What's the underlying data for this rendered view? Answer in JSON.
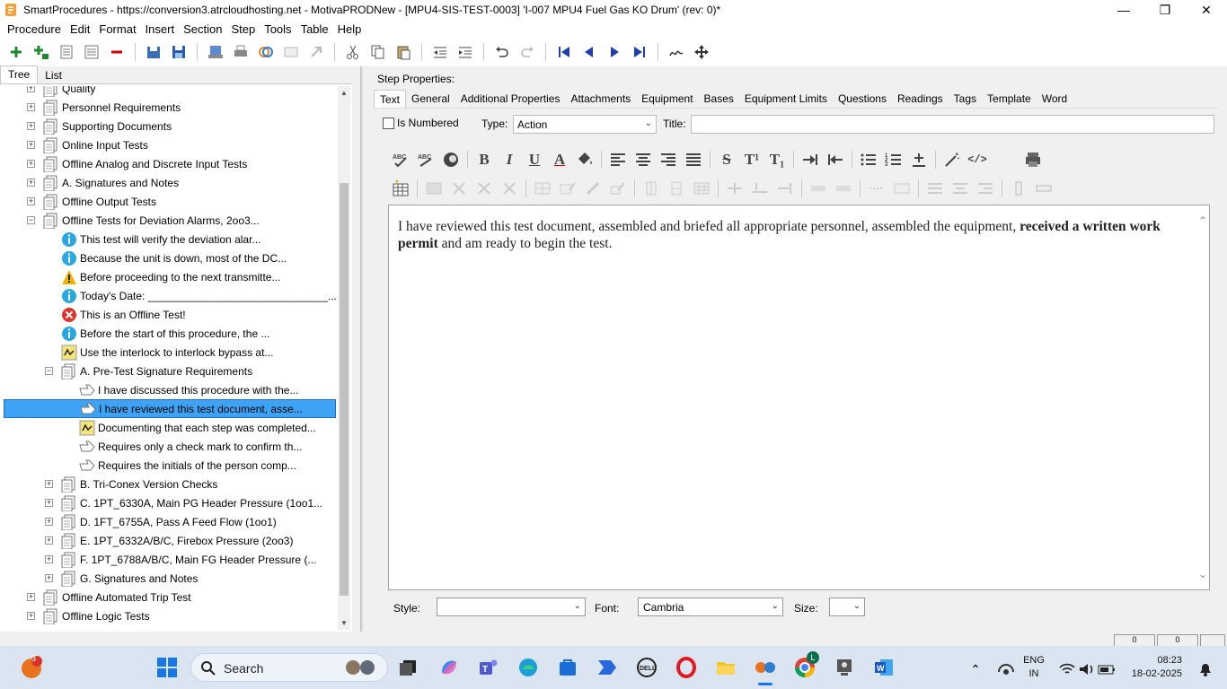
{
  "window": {
    "title": "SmartProcedures - https://conversion3.atrcloudhosting.net - MotivaPRODNew - [MPU4-SIS-TEST-0003] 'I-007 MPU4 Fuel Gas KO Drum' (rev: 0)*",
    "minimize": "—",
    "restore": "❐",
    "close": "✕"
  },
  "menu": [
    "Procedure",
    "Edit",
    "Format",
    "Insert",
    "Section",
    "Step",
    "Tools",
    "Table",
    "Help"
  ],
  "left_tabs": {
    "tree": "Tree",
    "list": "List"
  },
  "tree": [
    {
      "label": "Quality",
      "level": 0,
      "exp": "+",
      "icon": "section"
    },
    {
      "label": "Personnel Requirements",
      "level": 0,
      "exp": "+",
      "icon": "section"
    },
    {
      "label": "Supporting Documents",
      "level": 0,
      "exp": "+",
      "icon": "section"
    },
    {
      "label": "Online Input Tests",
      "level": 0,
      "exp": "+",
      "icon": "section"
    },
    {
      "label": "Offline Analog and Discrete Input Tests",
      "level": 0,
      "exp": "+",
      "icon": "section"
    },
    {
      "label": "A. Signatures and Notes",
      "level": 0,
      "exp": "+",
      "icon": "section"
    },
    {
      "label": "Offline Output Tests",
      "level": 0,
      "exp": "+",
      "icon": "section"
    },
    {
      "label": "Offline Tests for Deviation Alarms, 2oo3...",
      "level": 0,
      "exp": "−",
      "icon": "section"
    },
    {
      "label": "This test will verify the deviation alar...",
      "level": 1,
      "exp": "",
      "icon": "info"
    },
    {
      "label": "Because the unit is down, most of the DC...",
      "level": 1,
      "exp": "",
      "icon": "info"
    },
    {
      "label": "Before proceeding to the next transmitte...",
      "level": 1,
      "exp": "",
      "icon": "warning"
    },
    {
      "label": "Today's Date: ______________________________...",
      "level": 1,
      "exp": "",
      "icon": "info"
    },
    {
      "label": "This is an Offline Test!",
      "level": 1,
      "exp": "",
      "icon": "error"
    },
    {
      "label": "Before the start of this procedure, the ...",
      "level": 1,
      "exp": "",
      "icon": "info"
    },
    {
      "label": "Use the interlock to interlock bypass at...",
      "level": 1,
      "exp": "",
      "icon": "signoff"
    },
    {
      "label": "A. Pre-Test Signature Requirements",
      "level": 1,
      "exp": "−",
      "icon": "section"
    },
    {
      "label": "I have discussed this procedure with the...",
      "level": 2,
      "exp": "",
      "icon": "action"
    },
    {
      "label": "I have reviewed this test document, asse...",
      "level": 2,
      "exp": "",
      "icon": "action",
      "selected": true
    },
    {
      "label": "Documenting that each step was completed...",
      "level": 2,
      "exp": "",
      "icon": "signoff"
    },
    {
      "label": "Requires only a check mark to confirm th...",
      "level": 2,
      "exp": "",
      "icon": "action"
    },
    {
      "label": "Requires the initials of the person comp...",
      "level": 2,
      "exp": "",
      "icon": "action"
    },
    {
      "label": "B. Tri-Conex Version Checks",
      "level": 1,
      "exp": "+",
      "icon": "section"
    },
    {
      "label": "C. 1PT_6330A, Main PG Header Pressure (1oo1...",
      "level": 1,
      "exp": "+",
      "icon": "section"
    },
    {
      "label": "D. 1FT_6755A, Pass A Feed Flow (1oo1)",
      "level": 1,
      "exp": "+",
      "icon": "section"
    },
    {
      "label": "E. 1PT_6332A/B/C, Firebox Pressure (2oo3)",
      "level": 1,
      "exp": "+",
      "icon": "section"
    },
    {
      "label": "F. 1PT_6788A/B/C, Main FG Header Pressure (...",
      "level": 1,
      "exp": "+",
      "icon": "section"
    },
    {
      "label": "G. Signatures and Notes",
      "level": 1,
      "exp": "+",
      "icon": "section"
    },
    {
      "label": "Offline Automated Trip Test",
      "level": 0,
      "exp": "+",
      "icon": "section"
    },
    {
      "label": "Offline Logic Tests",
      "level": 0,
      "exp": "+",
      "icon": "section"
    }
  ],
  "step_properties": {
    "heading": "Step Properties:",
    "tabs": [
      "Text",
      "General",
      "Additional Properties",
      "Attachments",
      "Equipment",
      "Bases",
      "Equipment Limits",
      "Questions",
      "Readings",
      "Tags",
      "Template",
      "Word"
    ],
    "is_numbered_label": "Is Numbered",
    "type_label": "Type:",
    "type_value": "Action",
    "title_label": "Title:",
    "title_value": ""
  },
  "editor": {
    "text_normal_1": "I have reviewed this test document, assembled and briefed all appropriate personnel, assembled the equipment, ",
    "text_bold": "received a written work permit",
    "text_normal_2": " and am ready to begin the test."
  },
  "format_bar": {
    "bold": "B",
    "italic": "I",
    "underline": "U",
    "font_color": "A",
    "strike": "S",
    "superscript": "T¹",
    "subscript": "T₁",
    "code": "</>"
  },
  "bottom_fields": {
    "style_label": "Style:",
    "style_value": "",
    "font_label": "Font:",
    "font_value": "Cambria",
    "size_label": "Size:",
    "size_value": ""
  },
  "statusbar": {
    "cell1": "0",
    "cell2": "0"
  },
  "taskbar": {
    "search_label": "Search",
    "notification_count": "3",
    "chrome_badge": "L",
    "lang_line1": "ENG",
    "lang_line2": "IN",
    "time": "08:23",
    "date": "18-02-2025"
  },
  "colors": {
    "selection": "#3fa3f5",
    "info_icon": "#29a8e0",
    "error_icon": "#e0332c",
    "warning_icon": "#f0b400",
    "accent_blue": "#1e5bb8"
  }
}
